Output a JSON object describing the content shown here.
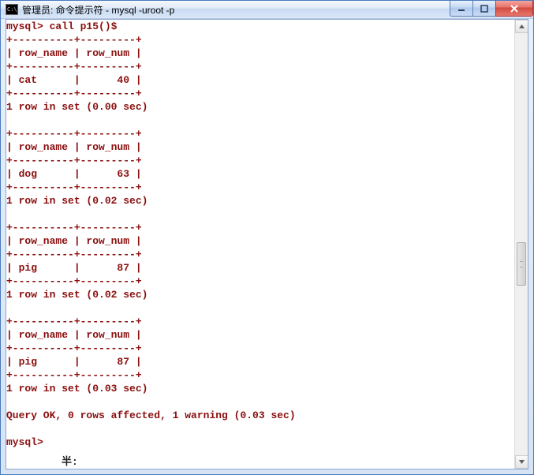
{
  "window": {
    "icon_label": "C:\\",
    "title": "管理员: 命令提示符 - mysql  -uroot -p"
  },
  "prompt": {
    "call_line": "mysql> call p15()$",
    "final_prompt": "mysql>"
  },
  "border": "+----------+---------+",
  "header": "| row_name | row_num |",
  "results": [
    {
      "name": "cat",
      "num": "40",
      "timing": "1 row in set (0.00 sec)"
    },
    {
      "name": "dog",
      "num": "63",
      "timing": "1 row in set (0.02 sec)"
    },
    {
      "name": "pig",
      "num": "87",
      "timing": "1 row in set (0.02 sec)"
    },
    {
      "name": "pig",
      "num": "87",
      "timing": "1 row in set (0.03 sec)"
    }
  ],
  "query_ok": "Query OK, 0 rows affected, 1 warning (0.03 sec)",
  "footer": "半:"
}
